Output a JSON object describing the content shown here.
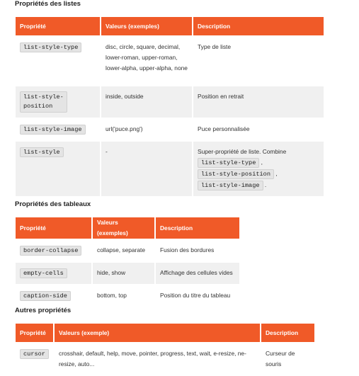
{
  "lists_section": {
    "title": "Propriétés des listes",
    "headers": [
      "Propriété",
      "Valeurs (exemples)",
      "Description"
    ],
    "rows": [
      {
        "property": "list-style-type",
        "values": "disc, circle, square, decimal, lower-roman, upper-roman, lower-alpha, upper-alpha, none",
        "description": "Type de liste"
      },
      {
        "property_line1": "list-style-",
        "property_line2": "position",
        "values": "inside, outside",
        "description": "Position en retrait"
      },
      {
        "property": "list-style-image",
        "values": "url('puce.png')",
        "description": "Puce personnalisée"
      },
      {
        "property": "list-style",
        "values": "-",
        "description_prefix": "Super-propriété de liste. Combine",
        "combined": [
          "list-style-type",
          "list-style-position",
          "list-style-image"
        ],
        "sep1": " ,",
        "sep2": " ,",
        "sep3": " ."
      }
    ]
  },
  "tables_section": {
    "title": "Propriétés des tableaux",
    "headers": [
      "Propriété",
      "Valeurs (exemples)",
      "Description"
    ],
    "rows": [
      {
        "property": "border-collapse",
        "values": "collapse, separate",
        "description": "Fusion des bordures"
      },
      {
        "property": "empty-cells",
        "values": "hide, show",
        "description": "Affichage des cellules vides"
      },
      {
        "property": "caption-side",
        "values": "bottom, top",
        "description": "Position du titre du tableau"
      }
    ]
  },
  "other_section": {
    "title": "Autres propriétés",
    "headers": [
      "Propriété",
      "Valeurs (exemple)",
      "Description"
    ],
    "rows": [
      {
        "property": "cursor",
        "values": "crosshair, default, help, move, pointer, progress, text, wait, e-resize, ne-resize, auto...",
        "description": "Curseur de souris"
      }
    ]
  },
  "colors": {
    "header_bg": "#f05a28",
    "alt_row_bg": "#f0f0f0"
  }
}
